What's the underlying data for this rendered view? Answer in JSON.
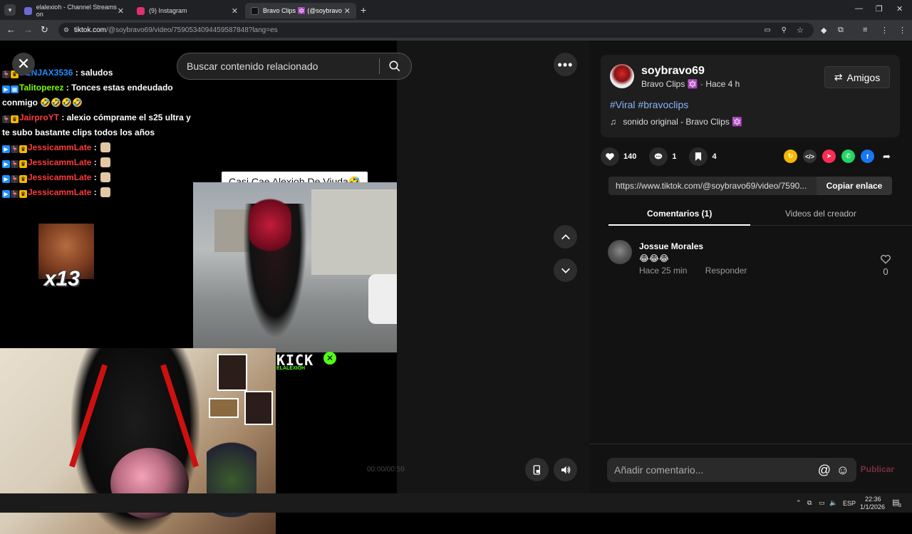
{
  "browser": {
    "tabs": [
      {
        "title": "elalexioh - Channel Streams on",
        "favicon_color": "#6b6bd6"
      },
      {
        "title": "(9) Instagram",
        "favicon_color": "#e1306c"
      },
      {
        "title": "Bravo Clips 🔯 (@soybravo",
        "favicon_color": "#111111"
      }
    ],
    "url_host": "tiktok.com",
    "url_path": "/@soybravo69/video/7590534094459587848?lang=es"
  },
  "overlay": {
    "chat": [
      {
        "user": "BENJAX3536",
        "user_color": "#1e90ff",
        "msg": " : saludos",
        "badges": [
          "🦩",
          "👑"
        ]
      },
      {
        "user": "Talitoperez",
        "user_color": "#7cfc00",
        "msg": " : Tonces estas endeudado conmigo 🤣🤣🤣🤣",
        "badges": [
          "⏩",
          "🎞"
        ]
      },
      {
        "user": "JairproYT",
        "user_color": "#ff3b3b",
        "msg": " : alexio cómprame el s25 ultra y te subo bastante clips todos los años",
        "badges": [
          "🦩",
          "👑"
        ]
      },
      {
        "user": "JessicammLate",
        "user_color": "#ff3b3b",
        "msg": " : ",
        "badges": [
          "⏩",
          "🦩",
          "👑"
        ]
      },
      {
        "user": "JessicammLate",
        "user_color": "#ff3b3b",
        "msg": " : ",
        "badges": [
          "⏩",
          "🦩",
          "👑"
        ]
      },
      {
        "user": "JessicammLate",
        "user_color": "#ff3b3b",
        "msg": " : ",
        "badges": [
          "⏩",
          "🦩",
          "👑"
        ]
      },
      {
        "user": "JessicammLate",
        "user_color": "#ff3b3b",
        "msg": " : ",
        "badges": [
          "⏩",
          "🦩",
          "👑"
        ]
      }
    ],
    "sticker_count": "x13",
    "video_caption": "Casi Cae Alexioh De Viuda🤣",
    "kick_logo": "KICK",
    "kick_sub": "ELALEXIOH",
    "timecode": "00:00/00:59"
  },
  "search": {
    "placeholder": "Buscar contenido relacionado"
  },
  "post": {
    "username": "soybravo69",
    "display_name": "Bravo Clips 🔯",
    "time_ago": "· Hace 4 h",
    "friends_label": "Amigos",
    "hashtags": "#Viral #bravoclips",
    "sound": "sonido original - Bravo Clips 🔯",
    "likes": "140",
    "comments": "1",
    "saves": "4",
    "link": "https://www.tiktok.com/@soybravo69/video/7590...",
    "copy_label": "Copiar enlace",
    "tab_comments": "Comentarios (1)",
    "tab_creator": "Videos del creador"
  },
  "comments": [
    {
      "name": "Jossue Morales",
      "text": "😂😂😂",
      "time": "Hace 25 min",
      "reply": "Responder",
      "likes": "0"
    }
  ],
  "composer": {
    "placeholder": "Añadir comentario...",
    "publish": "Publicar"
  },
  "taskbar": {
    "lang": "ESP",
    "time": "22:36",
    "date": "1/1/2026",
    "notif": "3"
  },
  "colors": {
    "accent_pink": "#fe2c55",
    "link_blue": "#8ab4f8"
  }
}
